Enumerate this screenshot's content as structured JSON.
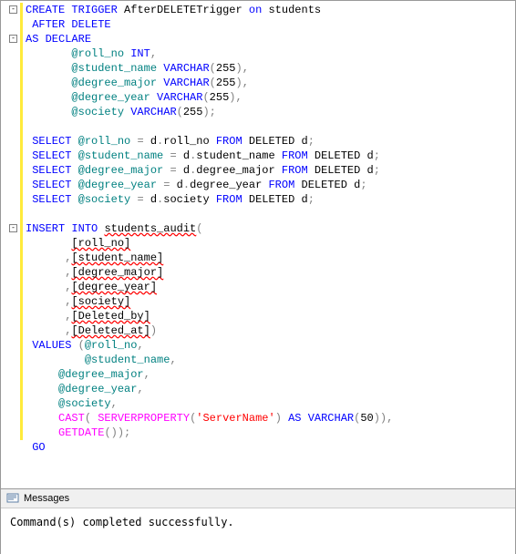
{
  "code": {
    "lines": [
      {
        "fold": true,
        "tokens": [
          [
            "kw",
            "CREATE"
          ],
          [
            "plain",
            " "
          ],
          [
            "kw",
            "TRIGGER"
          ],
          [
            "plain",
            " AfterDELETETrigger "
          ],
          [
            "kw",
            "on"
          ],
          [
            "plain",
            " students"
          ]
        ]
      },
      {
        "tokens": [
          [
            "plain",
            " "
          ],
          [
            "kw",
            "AFTER"
          ],
          [
            "plain",
            " "
          ],
          [
            "kw",
            "DELETE"
          ]
        ]
      },
      {
        "fold": true,
        "tokens": [
          [
            "kw",
            "AS"
          ],
          [
            "plain",
            " "
          ],
          [
            "kw",
            "DECLARE"
          ]
        ]
      },
      {
        "tokens": [
          [
            "plain",
            "       "
          ],
          [
            "var",
            "@roll_no"
          ],
          [
            "plain",
            " "
          ],
          [
            "kw",
            "INT"
          ],
          [
            "gray",
            ","
          ]
        ]
      },
      {
        "tokens": [
          [
            "plain",
            "       "
          ],
          [
            "var",
            "@student_name"
          ],
          [
            "plain",
            " "
          ],
          [
            "kw",
            "VARCHAR"
          ],
          [
            "gray",
            "("
          ],
          [
            "plain",
            "255"
          ],
          [
            "gray",
            ")"
          ],
          [
            "gray",
            ","
          ]
        ]
      },
      {
        "tokens": [
          [
            "plain",
            "       "
          ],
          [
            "var",
            "@degree_major"
          ],
          [
            "plain",
            " "
          ],
          [
            "kw",
            "VARCHAR"
          ],
          [
            "gray",
            "("
          ],
          [
            "plain",
            "255"
          ],
          [
            "gray",
            ")"
          ],
          [
            "gray",
            ","
          ]
        ]
      },
      {
        "tokens": [
          [
            "plain",
            "       "
          ],
          [
            "var",
            "@degree_year"
          ],
          [
            "plain",
            " "
          ],
          [
            "kw",
            "VARCHAR"
          ],
          [
            "gray",
            "("
          ],
          [
            "plain",
            "255"
          ],
          [
            "gray",
            ")"
          ],
          [
            "gray",
            ","
          ]
        ]
      },
      {
        "tokens": [
          [
            "plain",
            "       "
          ],
          [
            "var",
            "@society"
          ],
          [
            "plain",
            " "
          ],
          [
            "kw",
            "VARCHAR"
          ],
          [
            "gray",
            "("
          ],
          [
            "plain",
            "255"
          ],
          [
            "gray",
            ");"
          ]
        ]
      },
      {
        "tokens": [
          [
            "plain",
            " "
          ]
        ]
      },
      {
        "tokens": [
          [
            "plain",
            " "
          ],
          [
            "kw",
            "SELECT"
          ],
          [
            "plain",
            " "
          ],
          [
            "var",
            "@roll_no"
          ],
          [
            "plain",
            " "
          ],
          [
            "gray",
            "="
          ],
          [
            "plain",
            " d"
          ],
          [
            "gray",
            "."
          ],
          [
            "plain",
            "roll_no "
          ],
          [
            "kw",
            "FROM"
          ],
          [
            "plain",
            " DELETED d"
          ],
          [
            "gray",
            ";"
          ]
        ]
      },
      {
        "tokens": [
          [
            "plain",
            " "
          ],
          [
            "kw",
            "SELECT"
          ],
          [
            "plain",
            " "
          ],
          [
            "var",
            "@student_name"
          ],
          [
            "plain",
            " "
          ],
          [
            "gray",
            "="
          ],
          [
            "plain",
            " d"
          ],
          [
            "gray",
            "."
          ],
          [
            "plain",
            "student_name "
          ],
          [
            "kw",
            "FROM"
          ],
          [
            "plain",
            " DELETED d"
          ],
          [
            "gray",
            ";"
          ]
        ]
      },
      {
        "tokens": [
          [
            "plain",
            " "
          ],
          [
            "kw",
            "SELECT"
          ],
          [
            "plain",
            " "
          ],
          [
            "var",
            "@degree_major"
          ],
          [
            "plain",
            " "
          ],
          [
            "gray",
            "="
          ],
          [
            "plain",
            " d"
          ],
          [
            "gray",
            "."
          ],
          [
            "plain",
            "degree_major "
          ],
          [
            "kw",
            "FROM"
          ],
          [
            "plain",
            " DELETED d"
          ],
          [
            "gray",
            ";"
          ]
        ]
      },
      {
        "tokens": [
          [
            "plain",
            " "
          ],
          [
            "kw",
            "SELECT"
          ],
          [
            "plain",
            " "
          ],
          [
            "var",
            "@degree_year"
          ],
          [
            "plain",
            " "
          ],
          [
            "gray",
            "="
          ],
          [
            "plain",
            " d"
          ],
          [
            "gray",
            "."
          ],
          [
            "plain",
            "degree_year "
          ],
          [
            "kw",
            "FROM"
          ],
          [
            "plain",
            " DELETED d"
          ],
          [
            "gray",
            ";"
          ]
        ]
      },
      {
        "tokens": [
          [
            "plain",
            " "
          ],
          [
            "kw",
            "SELECT"
          ],
          [
            "plain",
            " "
          ],
          [
            "var",
            "@society"
          ],
          [
            "plain",
            " "
          ],
          [
            "gray",
            "="
          ],
          [
            "plain",
            " d"
          ],
          [
            "gray",
            "."
          ],
          [
            "plain",
            "society "
          ],
          [
            "kw",
            "FROM"
          ],
          [
            "plain",
            " DELETED d"
          ],
          [
            "gray",
            ";"
          ]
        ]
      },
      {
        "tokens": [
          [
            "plain",
            " "
          ]
        ]
      },
      {
        "fold": true,
        "tokens": [
          [
            "kw",
            "INSERT"
          ],
          [
            "plain",
            " "
          ],
          [
            "kw",
            "INTO"
          ],
          [
            "plain",
            " "
          ],
          [
            "squiggle",
            "students_audit"
          ],
          [
            "gray",
            "("
          ]
        ]
      },
      {
        "tokens": [
          [
            "plain",
            "       "
          ],
          [
            "squiggle",
            "[roll_no]"
          ]
        ]
      },
      {
        "tokens": [
          [
            "plain",
            "      "
          ],
          [
            "gray",
            ","
          ],
          [
            "squiggle",
            "[student_name]"
          ]
        ]
      },
      {
        "tokens": [
          [
            "plain",
            "      "
          ],
          [
            "gray",
            ","
          ],
          [
            "squiggle",
            "[degree_major]"
          ]
        ]
      },
      {
        "tokens": [
          [
            "plain",
            "      "
          ],
          [
            "gray",
            ","
          ],
          [
            "squiggle",
            "[degree_year]"
          ]
        ]
      },
      {
        "tokens": [
          [
            "plain",
            "      "
          ],
          [
            "gray",
            ","
          ],
          [
            "squiggle",
            "[society]"
          ]
        ]
      },
      {
        "tokens": [
          [
            "plain",
            "      "
          ],
          [
            "gray",
            ","
          ],
          [
            "squiggle",
            "[Deleted_by]"
          ]
        ]
      },
      {
        "tokens": [
          [
            "plain",
            "      "
          ],
          [
            "gray",
            ","
          ],
          [
            "squiggle",
            "[Deleted_at]"
          ],
          [
            "gray",
            ")"
          ]
        ]
      },
      {
        "tokens": [
          [
            "plain",
            " "
          ],
          [
            "kw",
            "VALUES"
          ],
          [
            "plain",
            " "
          ],
          [
            "gray",
            "("
          ],
          [
            "var",
            "@roll_no"
          ],
          [
            "gray",
            ","
          ]
        ]
      },
      {
        "tokens": [
          [
            "plain",
            "         "
          ],
          [
            "var",
            "@student_name"
          ],
          [
            "gray",
            ","
          ]
        ]
      },
      {
        "tokens": [
          [
            "plain",
            "     "
          ],
          [
            "var",
            "@degree_major"
          ],
          [
            "gray",
            ","
          ]
        ]
      },
      {
        "tokens": [
          [
            "plain",
            "     "
          ],
          [
            "var",
            "@degree_year"
          ],
          [
            "gray",
            ","
          ]
        ]
      },
      {
        "tokens": [
          [
            "plain",
            "     "
          ],
          [
            "var",
            "@society"
          ],
          [
            "gray",
            ","
          ]
        ]
      },
      {
        "tokens": [
          [
            "plain",
            "     "
          ],
          [
            "fn",
            "CAST"
          ],
          [
            "gray",
            "("
          ],
          [
            "plain",
            " "
          ],
          [
            "fn",
            "SERVERPROPERTY"
          ],
          [
            "gray",
            "("
          ],
          [
            "str",
            "'ServerName'"
          ],
          [
            "gray",
            ")"
          ],
          [
            "plain",
            " "
          ],
          [
            "kw",
            "AS"
          ],
          [
            "plain",
            " "
          ],
          [
            "kw",
            "VARCHAR"
          ],
          [
            "gray",
            "("
          ],
          [
            "plain",
            "50"
          ],
          [
            "gray",
            "))"
          ],
          [
            "gray",
            ","
          ]
        ]
      },
      {
        "tokens": [
          [
            "plain",
            "     "
          ],
          [
            "fn",
            "GETDATE"
          ],
          [
            "gray",
            "());"
          ]
        ]
      },
      {
        "noborder": true,
        "tokens": [
          [
            "plain",
            " "
          ],
          [
            "kw",
            "GO"
          ]
        ]
      }
    ]
  },
  "messages": {
    "tab_label": "Messages",
    "body": "Command(s) completed successfully."
  }
}
